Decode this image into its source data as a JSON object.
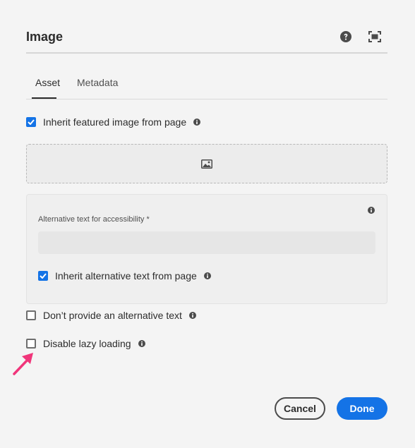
{
  "dialog": {
    "title": "Image",
    "help_icon": "help-circle-icon",
    "fullscreen_icon": "fullscreen-icon"
  },
  "tabs": [
    {
      "label": "Asset",
      "active": true
    },
    {
      "label": "Metadata",
      "active": false
    }
  ],
  "inherit_featured": {
    "label": "Inherit featured image from page",
    "checked": true
  },
  "dropzone": {
    "icon": "image-icon"
  },
  "alt_text": {
    "label": "Alternative text for accessibility *",
    "value": "",
    "inherit": {
      "label": "Inherit alternative text from page",
      "checked": true
    }
  },
  "no_alt": {
    "label": "Don’t provide an alternative text",
    "checked": false
  },
  "lazy_loading": {
    "label": "Disable lazy loading",
    "checked": false
  },
  "buttons": {
    "cancel": "Cancel",
    "done": "Done"
  },
  "colors": {
    "accent": "#1473e6",
    "annotation_arrow": "#f0357a"
  }
}
